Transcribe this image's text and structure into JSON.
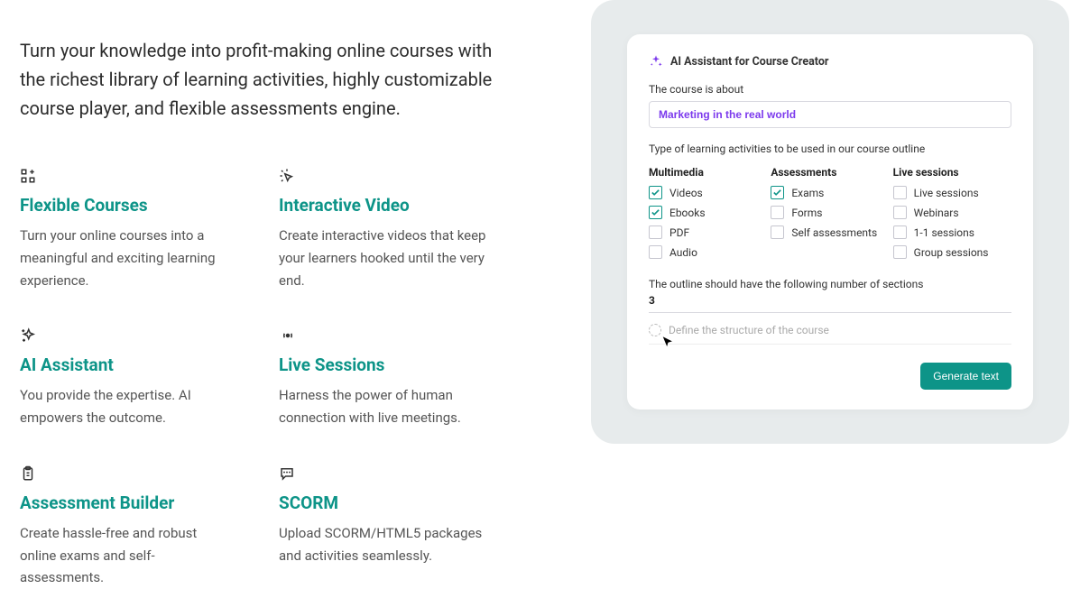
{
  "intro": "Turn your knowledge into profit-making online courses with the richest library of learning activities, highly customizable course player, and flexible assessments engine.",
  "features": [
    {
      "icon": "grid-plus",
      "title": "Flexible Courses",
      "desc": "Turn your online courses into a meaningful and exciting learning experience."
    },
    {
      "icon": "cursor-click",
      "title": "Interactive Video",
      "desc": "Create interactive videos that keep your learners hooked until the very end."
    },
    {
      "icon": "sparkles",
      "title": "AI Assistant",
      "desc": "You provide the expertise. AI empowers the outcome."
    },
    {
      "icon": "broadcast",
      "title": "Live Sessions",
      "desc": "Harness the power of human connection with live meetings."
    },
    {
      "icon": "clipboard",
      "title": "Assessment Builder",
      "desc": "Create hassle-free and robust online exams and self-assessments."
    },
    {
      "icon": "chat",
      "title": "SCORM",
      "desc": "Upload SCORM/HTML5 packages and activities seamlessly."
    }
  ],
  "panel": {
    "title": "AI Assistant for Course Creator",
    "topic_label": "The course is about",
    "topic_value": "Marketing in the real world",
    "activities_label": "Type of learning activities to be used in our course outline",
    "columns": {
      "multimedia": {
        "title": "Multimedia",
        "items": [
          {
            "label": "Videos",
            "checked": true
          },
          {
            "label": "Ebooks",
            "checked": true
          },
          {
            "label": "PDF",
            "checked": false
          },
          {
            "label": "Audio",
            "checked": false
          }
        ]
      },
      "assessments": {
        "title": "Assessments",
        "items": [
          {
            "label": "Exams",
            "checked": true
          },
          {
            "label": "Forms",
            "checked": false
          },
          {
            "label": "Self assessments",
            "checked": false
          }
        ]
      },
      "live": {
        "title": "Live sessions",
        "items": [
          {
            "label": "Live sessions",
            "checked": false
          },
          {
            "label": "Webinars",
            "checked": false
          },
          {
            "label": "1-1 sessions",
            "checked": false
          },
          {
            "label": "Group sessions",
            "checked": false
          }
        ]
      }
    },
    "sections_label": "The outline should have the following number of sections",
    "sections_value": "3",
    "structure_placeholder": "Define the structure of the course",
    "generate_label": "Generate text"
  }
}
